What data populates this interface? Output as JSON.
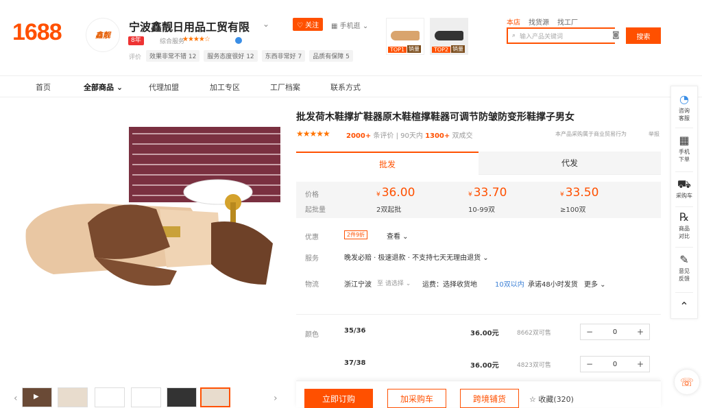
{
  "header": {
    "logo": "1688",
    "company_logo_text": "鑫靓",
    "company_name": "宁波鑫靓日用品工贸有限",
    "years_badge": "8年",
    "service_label": "综合服务",
    "service_stars": "★★★★☆",
    "rating_label": "评价",
    "rating_tags": [
      "效果非常不错 12",
      "服务态度很好 12",
      "东西非常好 7",
      "品质有保障 5"
    ],
    "follow": "关注",
    "mobile": "手机逛",
    "top1_label": "TOP1",
    "top1_sub": "销量",
    "top2_label": "TOP2",
    "top2_sub": "销量",
    "top_links": [
      "本店",
      "找货源",
      "找工厂"
    ],
    "search_placeholder": "输入产品关键词",
    "search_btn": "搜索"
  },
  "nav": {
    "items": [
      "首页",
      "全部商品",
      "代理加盟",
      "加工专区",
      "工厂档案",
      "联系方式"
    ]
  },
  "product": {
    "title": "批发荷木鞋撑扩鞋器原木鞋楦撑鞋器可调节防皱防变形鞋撑子男女",
    "stars": "★★★★★",
    "reviews": "2000+",
    "reviews_label": "条评价",
    "days_label": "90天内",
    "sold": "1300+",
    "sold_label": "双成交",
    "behavior_note": "本产品采购属于商业贸易行为",
    "report": "举报"
  },
  "tabs": {
    "wholesale": "批发",
    "dropship": "代发"
  },
  "pricing": {
    "price_label": "价格",
    "moq_label": "起批量",
    "currency": "¥",
    "tiers": [
      {
        "price": "36.00",
        "qty": "2双起批"
      },
      {
        "price": "33.70",
        "qty": "10-99双"
      },
      {
        "price": "33.50",
        "qty": "≥100双"
      }
    ]
  },
  "details": {
    "discount_label": "优惠",
    "discount_tag": "2件9折",
    "see_label": "查看",
    "service_label": "服务",
    "service_value": "晚发必赔 · 极速退款 · 不支持七天无理由退货",
    "logistics_label": "物流",
    "origin": "浙江宁波",
    "to": "至",
    "choose": "请选择",
    "freight": "运费：选择收货地",
    "within": "10双以内",
    "promise": "承诺48小时发货",
    "more": "更多"
  },
  "variants": {
    "label": "颜色",
    "rows": [
      {
        "size": "35/36",
        "price": "36.00元",
        "stock": "8662双可售",
        "qty": "0"
      },
      {
        "size": "37/38",
        "price": "36.00元",
        "stock": "4823双可售",
        "qty": "0"
      }
    ]
  },
  "actions": {
    "buy": "立即订购",
    "cart": "加采购车",
    "cross": "跨境铺货",
    "favorite": "收藏(320)"
  },
  "sidebar": [
    {
      "icon": "◔",
      "label": "咨询\n客服"
    },
    {
      "icon": "▦",
      "label": "手机\n下单"
    },
    {
      "icon": "⛟",
      "label": "采购车"
    },
    {
      "icon": "⅍",
      "label": "商品\n对比"
    },
    {
      "icon": "✎",
      "label": "意见\n反馈"
    },
    {
      "icon": "⌃",
      "label": ""
    }
  ],
  "colors": {
    "accent": "#ff5000",
    "link": "#3a7fd5"
  }
}
